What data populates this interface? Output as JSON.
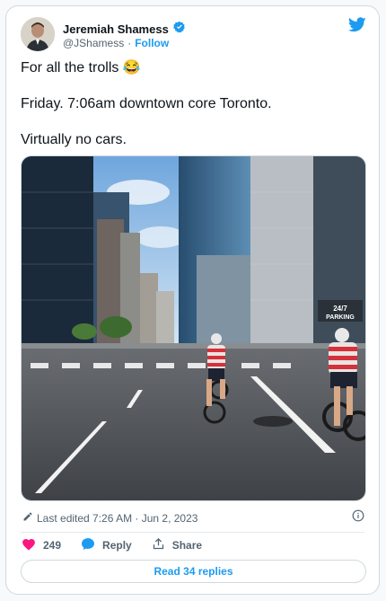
{
  "author": {
    "name": "Jeremiah Shamess",
    "handle": "@JShamess",
    "separator": "·",
    "follow_label": "Follow"
  },
  "tweet": {
    "lines": [
      "For all the trolls 😂",
      "Friday. 7:06am downtown core Toronto.",
      "Virtually no cars."
    ]
  },
  "photo": {
    "sign_texts": [
      "24/7",
      "PARKING"
    ]
  },
  "meta": {
    "edited_text": "Last edited 7:26 AM · Jun 2, 2023"
  },
  "actions": {
    "likes_count": "249",
    "reply_label": "Reply",
    "share_label": "Share"
  },
  "footer": {
    "read_replies_label": "Read 34 replies"
  },
  "colors": {
    "accent": "#1d9bf0",
    "like": "#f91880",
    "muted": "#536471"
  }
}
